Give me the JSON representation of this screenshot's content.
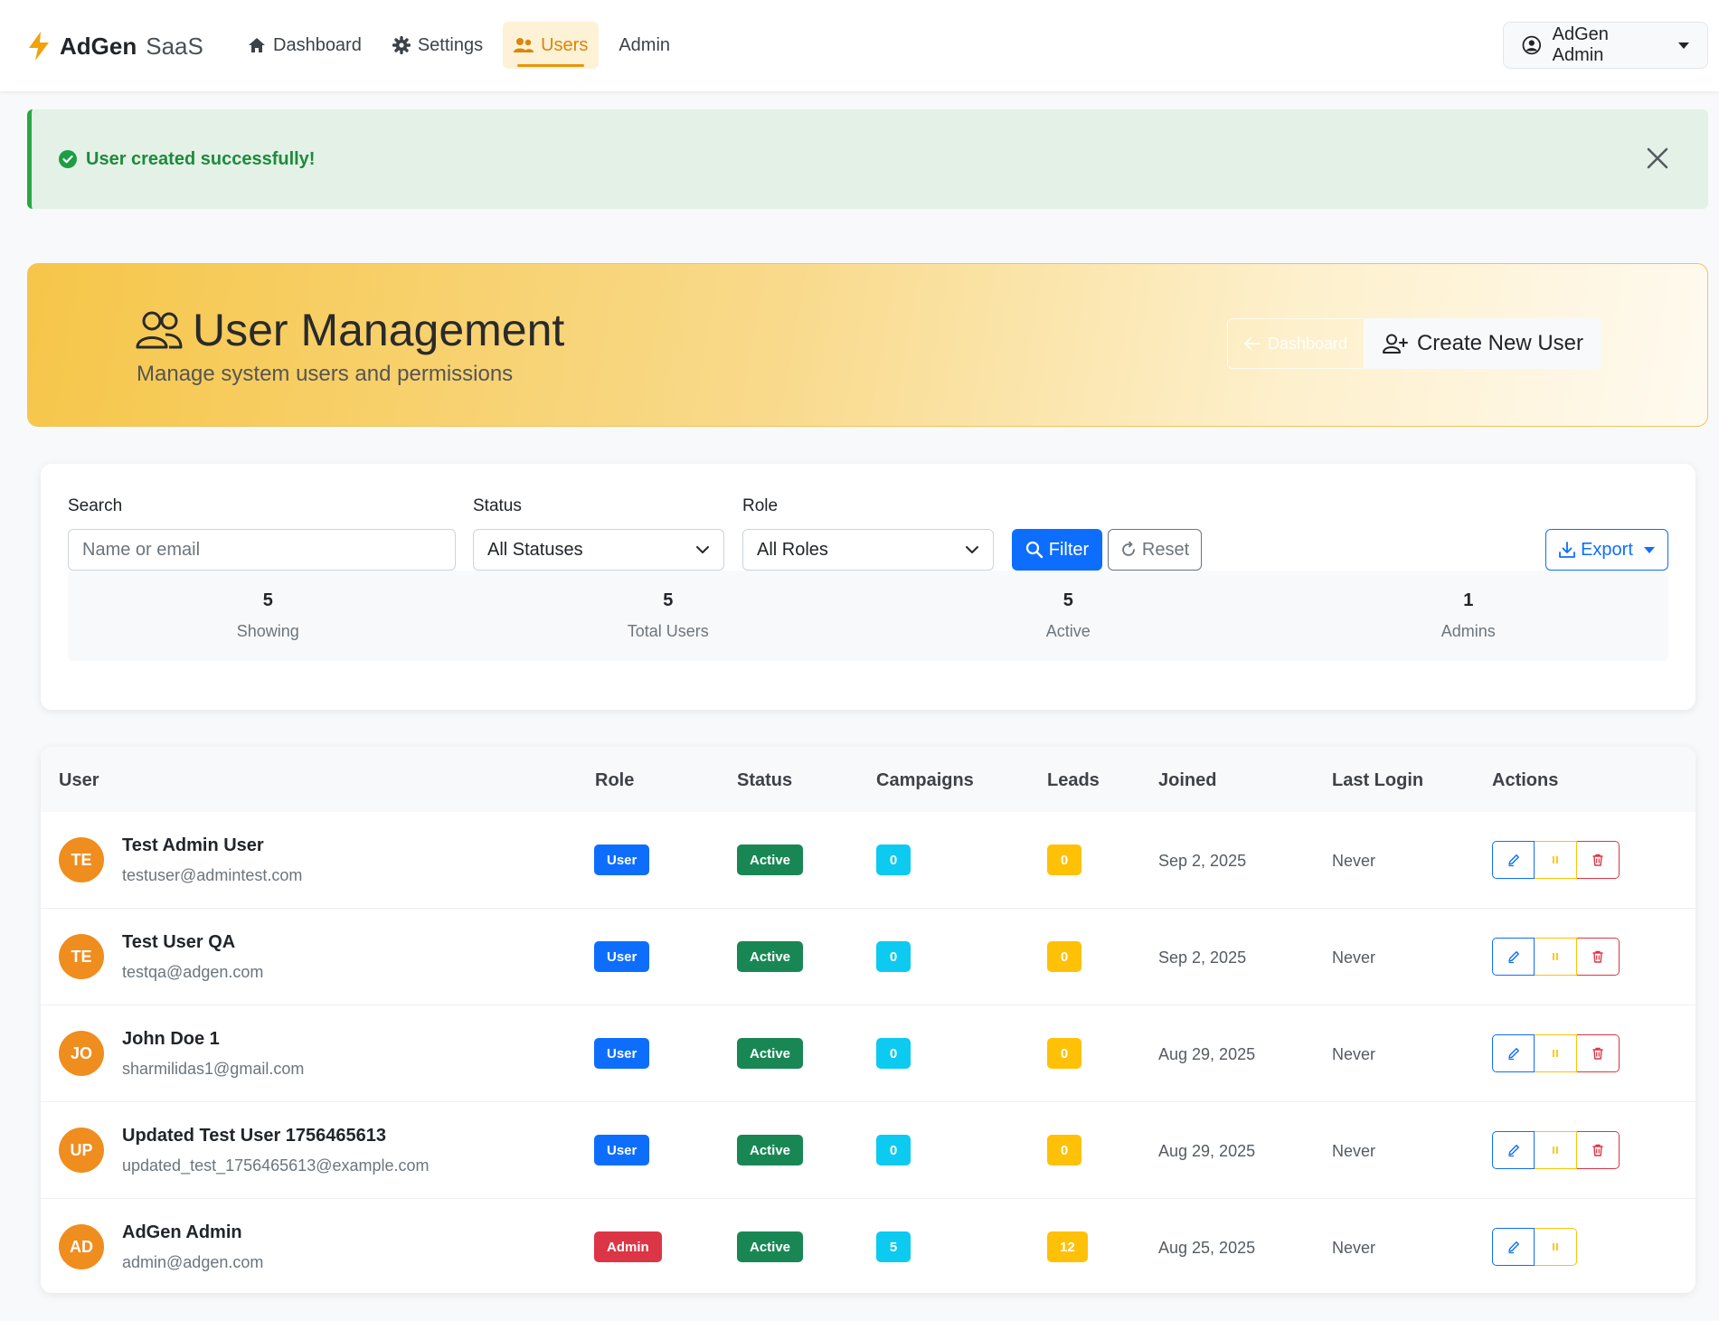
{
  "brand": {
    "name_bold": "AdGen",
    "name_light": "SaaS"
  },
  "nav": {
    "items": [
      {
        "label": "Dashboard",
        "icon": "home-icon"
      },
      {
        "label": "Settings",
        "icon": "gear-icon"
      },
      {
        "label": "Users",
        "icon": "users-icon",
        "active": true
      },
      {
        "label": "Admin",
        "icon": ""
      }
    ],
    "user_menu_label": "AdGen Admin"
  },
  "alert": {
    "message": "User created successfully!",
    "type": "success"
  },
  "hero": {
    "title": "User Management",
    "subtitle": "Manage system users and permissions",
    "back_label": "Dashboard",
    "create_label": "Create New User"
  },
  "filters": {
    "search_label": "Search",
    "search_placeholder": "Name or email",
    "status_label": "Status",
    "status_selected": "All Statuses",
    "role_label": "Role",
    "role_selected": "All Roles",
    "filter_label": "Filter",
    "reset_label": "Reset",
    "export_label": "Export"
  },
  "stats": [
    {
      "value": "5",
      "label": "Showing"
    },
    {
      "value": "5",
      "label": "Total Users"
    },
    {
      "value": "5",
      "label": "Active"
    },
    {
      "value": "1",
      "label": "Admins"
    }
  ],
  "table": {
    "headers": [
      "User",
      "Role",
      "Status",
      "Campaigns",
      "Leads",
      "Joined",
      "Last Login",
      "Actions"
    ],
    "rows": [
      {
        "initials": "TE",
        "name": "Test Admin User",
        "email": "testuser@admintest.com",
        "role": "User",
        "status": "Active",
        "campaigns": "0",
        "leads": "0",
        "joined": "Sep 2, 2025",
        "last_login": "Never"
      },
      {
        "initials": "TE",
        "name": "Test User QA",
        "email": "testqa@adgen.com",
        "role": "User",
        "status": "Active",
        "campaigns": "0",
        "leads": "0",
        "joined": "Sep 2, 2025",
        "last_login": "Never"
      },
      {
        "initials": "JO",
        "name": "John Doe 1",
        "email": "sharmilidas1@gmail.com",
        "role": "User",
        "status": "Active",
        "campaigns": "0",
        "leads": "0",
        "joined": "Aug 29, 2025",
        "last_login": "Never"
      },
      {
        "initials": "UP",
        "name": "Updated Test User 1756465613",
        "email": "updated_test_1756465613@example.com",
        "role": "User",
        "status": "Active",
        "campaigns": "0",
        "leads": "0",
        "joined": "Aug 29, 2025",
        "last_login": "Never"
      },
      {
        "initials": "AD",
        "name": "AdGen Admin",
        "email": "admin@adgen.com",
        "role": "Admin",
        "status": "Active",
        "campaigns": "5",
        "leads": "12",
        "joined": "Aug 25, 2025",
        "last_login": "Never"
      }
    ]
  },
  "colors": {
    "primary": "#0d6efd",
    "success": "#198754",
    "danger": "#dc3545",
    "warning": "#ffc107",
    "info": "#0dcaf0",
    "accent": "#e8950c"
  }
}
